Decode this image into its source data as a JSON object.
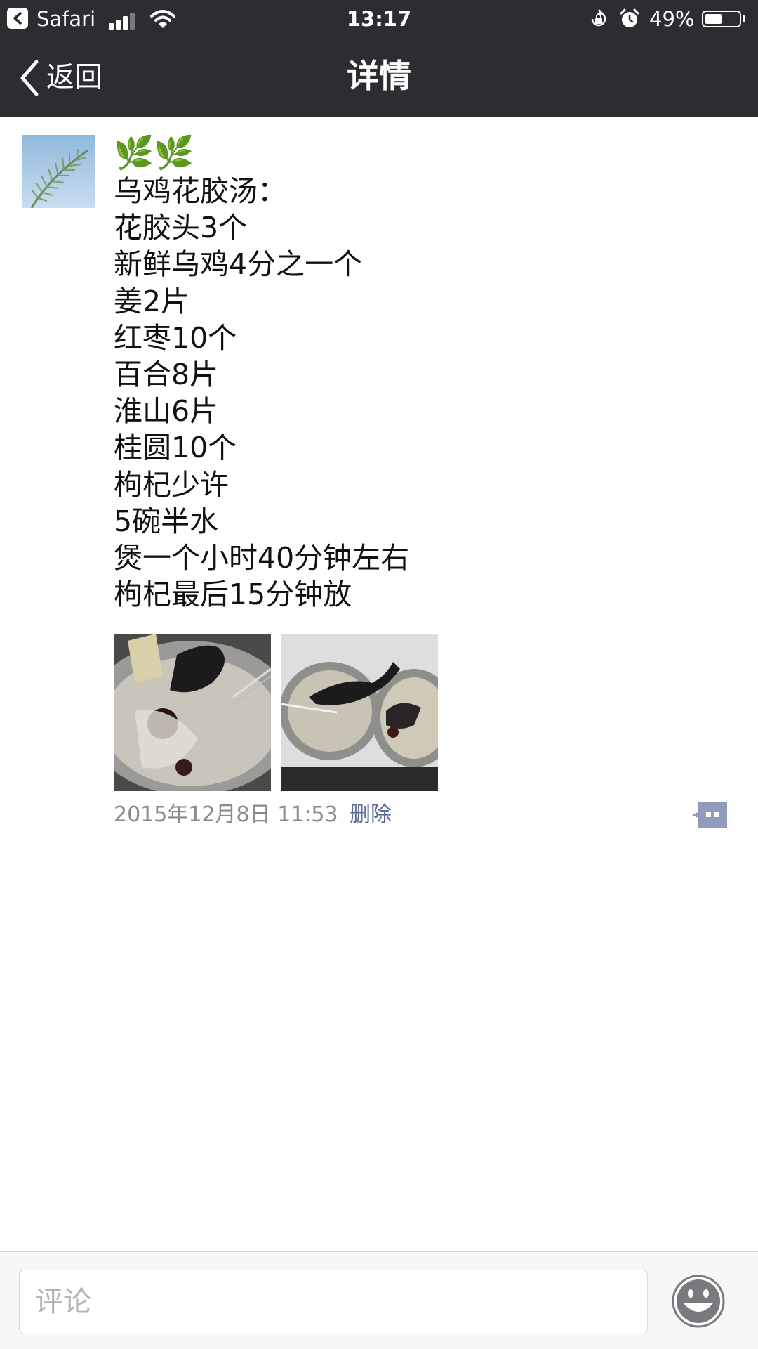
{
  "status_bar": {
    "back_app": "Safari",
    "time": "13:17",
    "battery_percent": "49%",
    "battery_level": 0.49,
    "icons": [
      "back-to-app-icon",
      "cellular-signal-icon",
      "wifi-icon",
      "orientation-lock-icon",
      "alarm-icon",
      "battery-icon"
    ]
  },
  "nav": {
    "back_label": "返回",
    "title": "详情"
  },
  "post": {
    "emoji": "🌿🌿",
    "text": "乌鸡花胶汤：\n花胶头3个\n新鲜乌鸡4分之一个\n姜2片\n红枣10个\n百合8片\n淮山6片\n桂圆10个\n枸杞少许\n5碗半水\n煲一个小时40分钟左右\n枸杞最后15分钟放",
    "timestamp": "2015年12月8日 11:53",
    "delete_label": "删除"
  },
  "input": {
    "placeholder": "评论"
  },
  "colors": {
    "header_bg": "#2d2d31",
    "link": "#5b6b95",
    "meta": "#8a8a8a"
  }
}
